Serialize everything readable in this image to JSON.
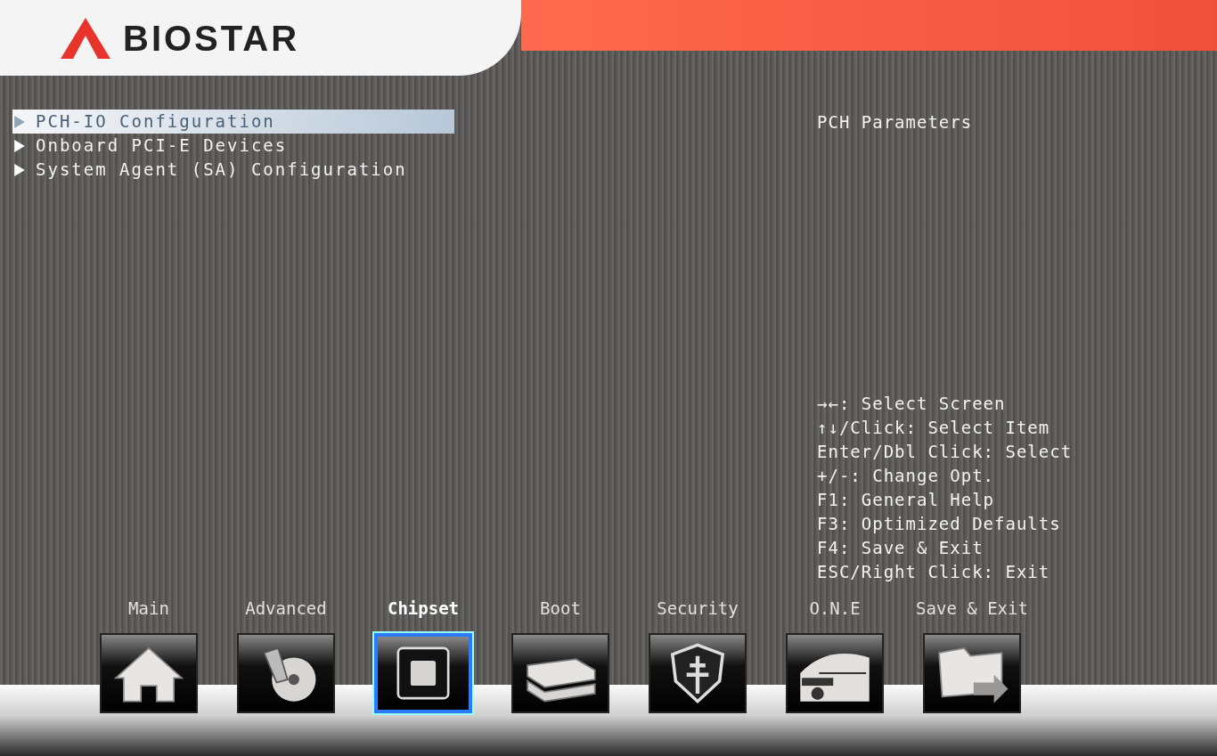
{
  "logo": {
    "text": "BIOSTAR"
  },
  "menu": [
    {
      "label": "PCH-IO Configuration",
      "selected": true
    },
    {
      "label": "Onboard PCI-E Devices",
      "selected": false
    },
    {
      "label": "System Agent (SA) Configuration",
      "selected": false
    }
  ],
  "help": {
    "description": "PCH Parameters",
    "keys": [
      "→←: Select Screen",
      "↑↓/Click: Select Item",
      "Enter/Dbl Click: Select",
      "+/-: Change Opt.",
      "F1: General Help",
      "F3: Optimized Defaults",
      "F4: Save & Exit",
      "ESC/Right Click: Exit"
    ]
  },
  "tabs": [
    {
      "label": "Main",
      "selected": false
    },
    {
      "label": "Advanced",
      "selected": false
    },
    {
      "label": "Chipset",
      "selected": true
    },
    {
      "label": "Boot",
      "selected": false
    },
    {
      "label": "Security",
      "selected": false
    },
    {
      "label": "O.N.E",
      "selected": false
    },
    {
      "label": "Save & Exit",
      "selected": false
    }
  ]
}
